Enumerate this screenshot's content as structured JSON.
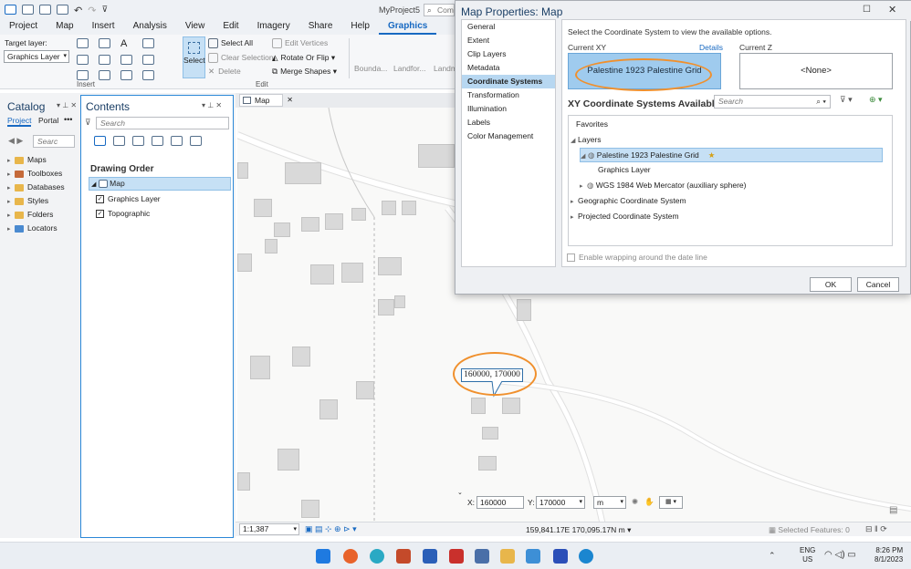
{
  "titlebar": {
    "project_name": "MyProject5",
    "command_search_placeholder": "Comm"
  },
  "menu": {
    "tabs": [
      "Project",
      "Map",
      "Insert",
      "Analysis",
      "View",
      "Edit",
      "Imagery",
      "Share",
      "Help",
      "Graphics"
    ],
    "active_tab": "Graphics"
  },
  "ribbon": {
    "target_layer_label": "Target layer:",
    "target_layer_value": "Graphics Layer",
    "insert_group_label": "Insert",
    "select_label": "Select",
    "select_all_label": "Select All",
    "clear_selection_label": "Clear Selection",
    "delete_label": "Delete",
    "edit_vertices_label": "Edit Vertices",
    "rotate_flip_label": "Rotate Or Flip",
    "merge_shapes_label": "Merge Shapes",
    "edit_group_label": "Edit",
    "gallery": [
      "Bounda...",
      "Landfor...",
      "Landm"
    ]
  },
  "catalog": {
    "title": "Catalog",
    "tabs": [
      "Project",
      "Portal"
    ],
    "search_placeholder": "Searc",
    "items": [
      "Maps",
      "Toolboxes",
      "Databases",
      "Styles",
      "Folders",
      "Locators"
    ]
  },
  "contents": {
    "title": "Contents",
    "search_placeholder": "Search",
    "heading": "Drawing Order",
    "map_item": "Map",
    "layers": [
      "Graphics Layer",
      "Topographic"
    ]
  },
  "map_view": {
    "tab_label": "Map",
    "label_text": "160000, 170000",
    "x_label": "X:",
    "x_value": "160000",
    "y_label": "Y:",
    "y_value": "170000",
    "unit": "m"
  },
  "status": {
    "scale": "1:1,387",
    "coordinates": "159,841.17E 170,095.17N m",
    "selected_features": "Selected Features: 0"
  },
  "dialog": {
    "title": "Map Properties: Map",
    "nav_items": [
      "General",
      "Extent",
      "Clip Layers",
      "Metadata",
      "Coordinate Systems",
      "Transformation",
      "Illumination",
      "Labels",
      "Color Management"
    ],
    "selected_nav": "Coordinate Systems",
    "instruction": "Select the Coordinate System to view the available options.",
    "current_xy_label": "Current XY",
    "details_link": "Details",
    "current_xy_value": "Palestine 1923 Palestine Grid",
    "current_z_label": "Current Z",
    "current_z_value": "<None>",
    "available_label": "XY Coordinate Systems Available",
    "search_placeholder": "Search",
    "tree": {
      "favorites": "Favorites",
      "layers": "Layers",
      "selected_cs": "Palestine 1923 Palestine Grid",
      "graphics_layer": "Graphics Layer",
      "web_mercator": "WGS 1984 Web Mercator (auxiliary sphere)",
      "geographic": "Geographic Coordinate System",
      "projected": "Projected Coordinate System"
    },
    "wrap_label": "Enable wrapping around the date line",
    "ok_label": "OK",
    "cancel_label": "Cancel"
  },
  "taskbar": {
    "language": "ENG",
    "region": "US",
    "time": "8:26 PM",
    "date": "8/1/2023"
  },
  "colors": {
    "accent": "#1769c2",
    "annotation": "#f0902d",
    "selection": "#b7d7f1"
  }
}
